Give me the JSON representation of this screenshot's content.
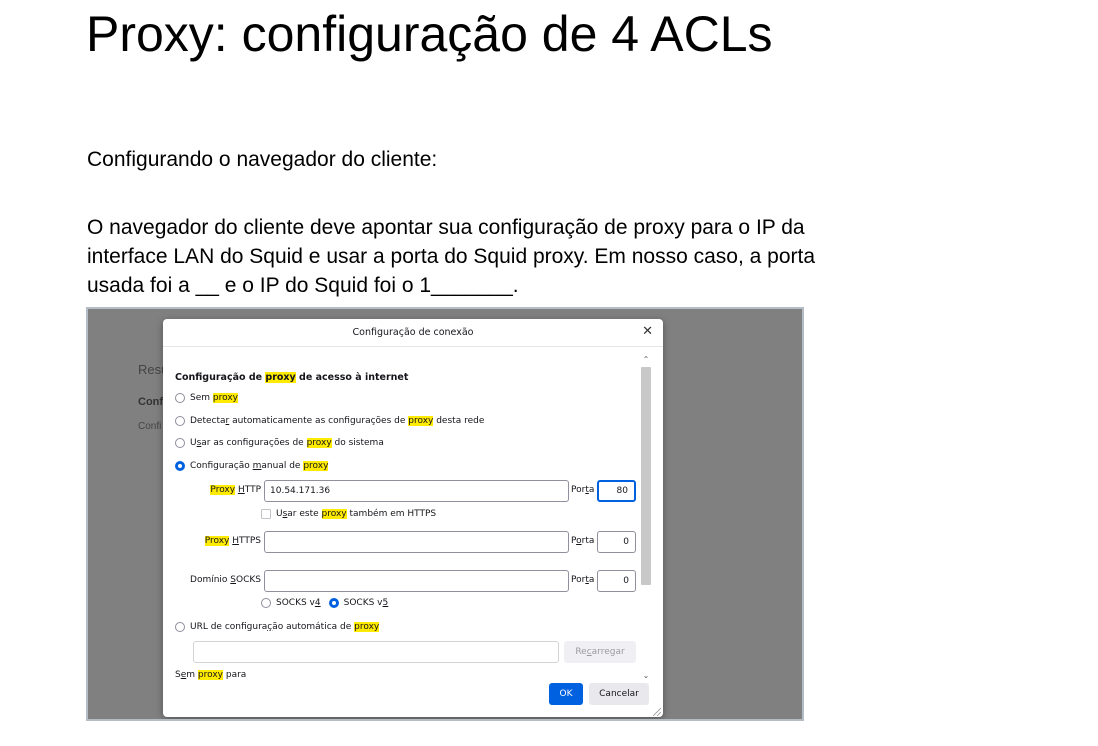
{
  "document": {
    "title": "Proxy: configuração de 4 ACLs",
    "paragraph1": "Configurando o navegador do cliente:",
    "paragraph2_lines": [
      "O navegador do cliente deve apontar sua configuração de proxy para o IP da",
      "interface LAN do Squid e usar a porta do Squid proxy. Em nosso caso, a porta",
      "usada foi a __ e o IP do Squid foi o 1_______."
    ]
  },
  "background": {
    "text1": "Resu",
    "text2": "Conf",
    "text3": "Confi"
  },
  "dialog": {
    "title": "Configuração de conexão",
    "close_glyph": "✕",
    "section_title": [
      "Configuração de ",
      "proxy",
      " de acesso à internet"
    ],
    "options": {
      "no_proxy": [
        "Sem ",
        "proxy"
      ],
      "auto_detect": [
        "Detecta",
        "r",
        " automaticamente as configurações de ",
        "proxy",
        " desta rede"
      ],
      "system": [
        "U",
        "s",
        "ar as configurações de ",
        "proxy",
        " do sistema"
      ],
      "manual": [
        "Configuração ",
        "m",
        "anual de ",
        "proxy"
      ],
      "auto_url": [
        "URL de configura",
        "ç",
        "ão automática de ",
        "proxy"
      ]
    },
    "http": {
      "label": [
        "Proxy",
        " ",
        "H",
        "TTP"
      ],
      "value": "10.54.171.36",
      "port_label": [
        "Por",
        "t",
        "a"
      ],
      "port_value": "80"
    },
    "https_checkbox": [
      "U",
      "s",
      "ar este ",
      "proxy",
      " também em HTTPS"
    ],
    "https": {
      "label": [
        "Proxy",
        " ",
        "H",
        "TTPS"
      ],
      "value": "",
      "port_label": [
        "P",
        "o",
        "rta"
      ],
      "port_value": "0"
    },
    "socks": {
      "label": [
        "Domínio ",
        "S",
        "OCKS"
      ],
      "value": "",
      "port_label": [
        "Por",
        "t",
        "a"
      ],
      "port_value": "0",
      "v4": [
        "SOCKS v",
        "4"
      ],
      "v5": [
        "SOCKS v",
        "5"
      ]
    },
    "auto_url_value": "",
    "reload_label": [
      "Re",
      "c",
      "arregar"
    ],
    "no_proxy_for": [
      "S",
      "e",
      "m ",
      "proxy",
      " para"
    ],
    "ok_label": "OK",
    "cancel_label": "Cancelar",
    "scroll_up": "⌃",
    "scroll_down": "⌄",
    "colors": {
      "accent": "#0061e0",
      "highlight": "#ffeb00",
      "overlay": "#808080"
    }
  }
}
